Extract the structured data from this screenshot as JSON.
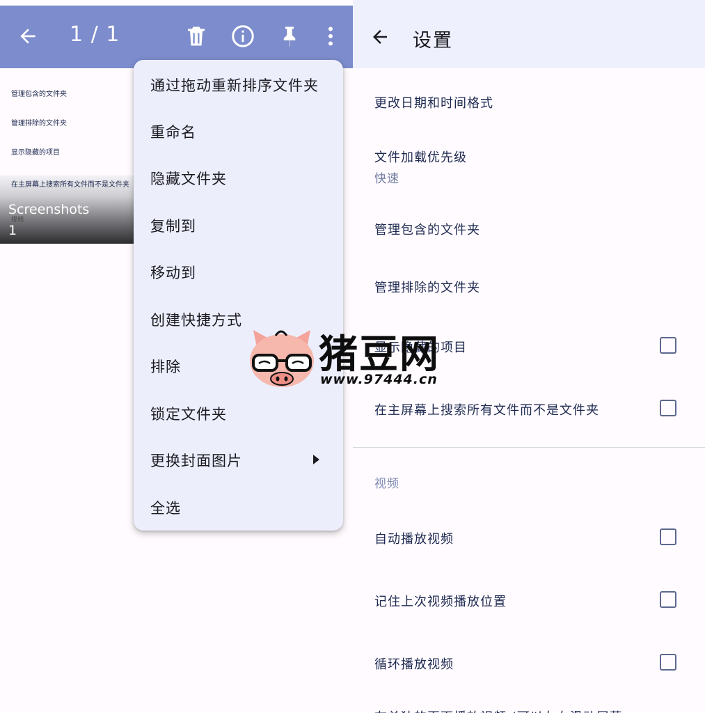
{
  "left_panel": {
    "toolbar": {
      "counter": "1 / 1",
      "icons": [
        "back-arrow-icon",
        "trash-icon",
        "info-icon",
        "pin-icon",
        "more-vert-icon"
      ]
    },
    "background_items": [
      "管理包含的文件夹",
      "管理排除的文件夹",
      "显示隐藏的项目",
      "在主屏幕上搜索所有文件而不是文件夹"
    ],
    "folder": {
      "name": "Screenshots",
      "sub": "视频",
      "count": "1"
    }
  },
  "menu": {
    "items": [
      {
        "label": "通过拖动重新排序文件夹"
      },
      {
        "label": "重命名"
      },
      {
        "label": "隐藏文件夹"
      },
      {
        "label": "复制到"
      },
      {
        "label": "移动到"
      },
      {
        "label": "创建快捷方式"
      },
      {
        "label": "排除"
      },
      {
        "label": "锁定文件夹"
      },
      {
        "label": "更换封面图片",
        "submenu": true
      },
      {
        "label": "全选"
      }
    ]
  },
  "settings": {
    "title": "设置",
    "prefs": [
      {
        "title": "更改日期和时间格式"
      },
      {
        "title": "文件加载优先级",
        "summary": "快速"
      },
      {
        "title": "管理包含的文件夹"
      },
      {
        "title": "管理排除的文件夹"
      },
      {
        "title": "显示隐藏的项目",
        "checked": false
      },
      {
        "title": "在主屏幕上搜索所有文件而不是文件夹",
        "checked": false
      }
    ],
    "section_title": "视频",
    "video_prefs": [
      {
        "title": "自动播放视频",
        "checked": false
      },
      {
        "title": "记住上次视频播放位置",
        "checked": false
      },
      {
        "title": "循环播放视频",
        "checked": false
      },
      {
        "title": "在单独的页面播放视频 (可以左右滑动屏幕",
        "checked": false
      }
    ]
  },
  "watermark": {
    "text": "猪豆网",
    "url": "www.97444.cn"
  },
  "colors": {
    "toolbar_left": "#7c8ccc",
    "toolbar_right": "#eef0fd",
    "menu_bg": "#eceefc",
    "text_dark": "#1e2a50",
    "section": "#7f8bb3",
    "checkbox": "#5d6890"
  }
}
